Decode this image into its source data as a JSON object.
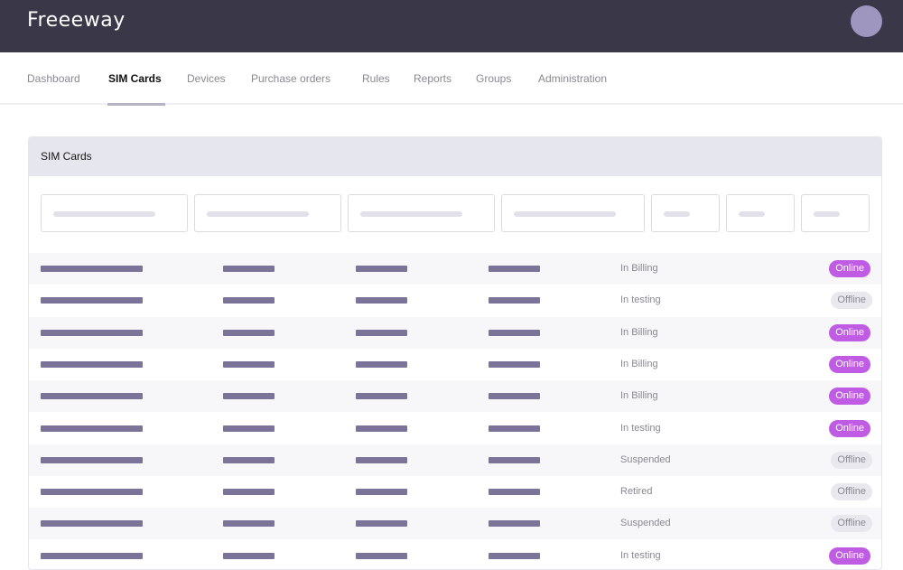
{
  "app": {
    "logo_text": "Freeeway"
  },
  "nav": {
    "tabs": [
      {
        "label": "Dashboard"
      },
      {
        "label": "SIM Cards"
      },
      {
        "label": "Devices"
      },
      {
        "label": "Purchase orders"
      },
      {
        "label": "Rules"
      },
      {
        "label": "Reports"
      },
      {
        "label": "Groups"
      },
      {
        "label": "Administration"
      }
    ],
    "active_tab": "SIM Cards"
  },
  "card": {
    "title": "SIM Cards"
  },
  "table": {
    "rows": [
      {
        "status": "In Billing",
        "connection": "Online"
      },
      {
        "status": "In testing",
        "connection": "Offline"
      },
      {
        "status": "In Billing",
        "connection": "Online"
      },
      {
        "status": "In Billing",
        "connection": "Online"
      },
      {
        "status": "In Billing",
        "connection": "Online"
      },
      {
        "status": "In testing",
        "connection": "Online"
      },
      {
        "status": "Suspended",
        "connection": "Offline"
      },
      {
        "status": "Retired",
        "connection": "Offline"
      },
      {
        "status": "Suspended",
        "connection": "Offline"
      },
      {
        "status": "In testing",
        "connection": "Online"
      }
    ]
  },
  "colors": {
    "topbar": "#3a3749",
    "online_badge": "#c05be4",
    "offline_badge": "#e9e8ee",
    "placeholder_bar": "#7b7498"
  }
}
